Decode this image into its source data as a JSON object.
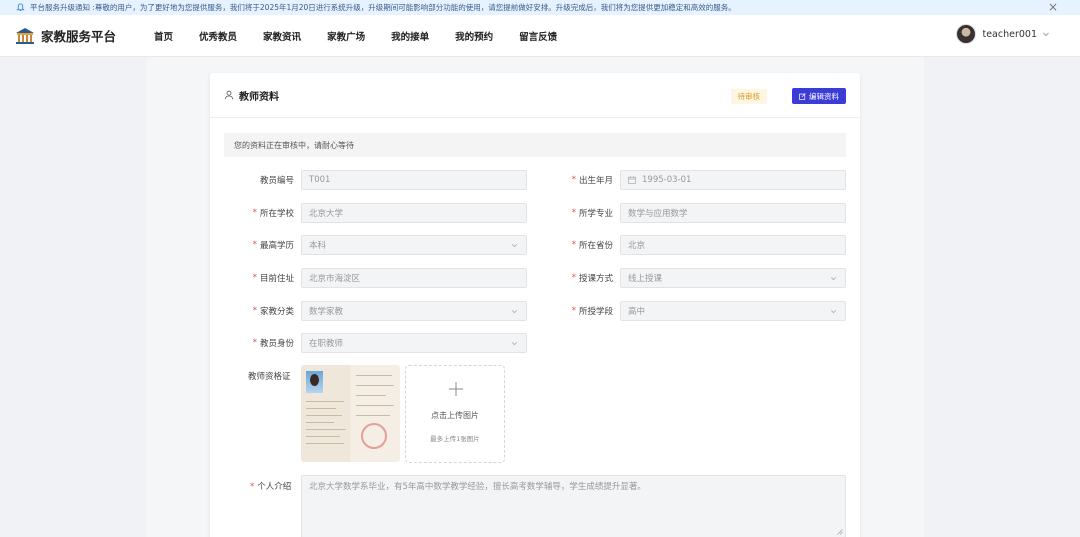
{
  "notice": {
    "text": "平台服务升级通知 :尊敬的用户，为了更好地为您提供服务，我们将于2025年1月20日进行系统升级，升级期间可能影响部分功能的使用，请您提前做好安排。升级完成后，我们将为您提供更加稳定和高效的服务。",
    "close": "×"
  },
  "brand": {
    "name": "家教服务平台"
  },
  "nav": {
    "items": [
      {
        "label": "首页"
      },
      {
        "label": "优秀教员"
      },
      {
        "label": "家教资讯"
      },
      {
        "label": "家教广场"
      },
      {
        "label": "我的接单"
      },
      {
        "label": "我的预约"
      },
      {
        "label": "留言反馈"
      }
    ]
  },
  "user": {
    "name": "teacher001"
  },
  "card": {
    "title": "教师资料",
    "status_badge": "待审核",
    "edit_button": "编辑资料",
    "alert": "您的资料正在审核中，请耐心等待"
  },
  "form": {
    "teacher_no": {
      "label": "教员编号",
      "value": "T001"
    },
    "birth": {
      "label": "出生年月",
      "value": "1995-03-01"
    },
    "school": {
      "label": "所在学校",
      "value": "北京大学"
    },
    "major": {
      "label": "所学专业",
      "value": "数学与应用数学"
    },
    "education": {
      "label": "最高学历",
      "value": "本科"
    },
    "province": {
      "label": "所在省份",
      "value": "北京"
    },
    "address": {
      "label": "目前住址",
      "value": "北京市海淀区"
    },
    "teach_mode": {
      "label": "授课方式",
      "value": "线上授课"
    },
    "category": {
      "label": "家教分类",
      "value": "数学家教"
    },
    "stage": {
      "label": "所授学段",
      "value": "高中"
    },
    "identity": {
      "label": "教员身份",
      "value": "在职教师"
    },
    "certificate": {
      "label": "教师资格证",
      "upload_text": "点击上传图片",
      "upload_hint": "最多上传1张图片"
    },
    "intro": {
      "label": "个人介绍",
      "value": "北京大学数学系毕业，有5年高中数学教学经验，擅长高考数学辅导，学生成绩提升显著。"
    }
  },
  "colors": {
    "primary": "#3b3bd6",
    "required": "#e84a4a",
    "badge_text": "#d99a1e",
    "badge_bg": "#fdf6e3",
    "notice_bg": "#e6f2ff"
  }
}
